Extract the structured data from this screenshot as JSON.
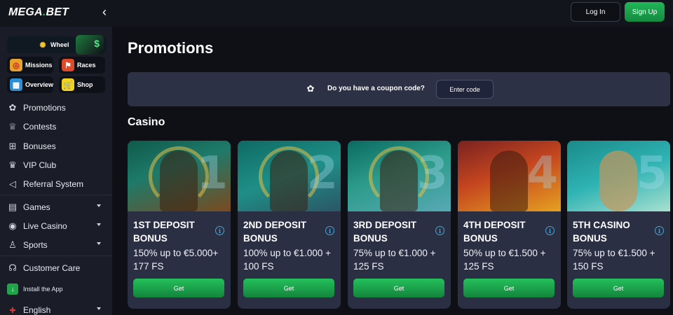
{
  "header": {
    "logo_main": "MEGA",
    "logo_dot": ".",
    "logo_suffix": "BET",
    "collapse_glyph": "‹",
    "login_label": "Log In",
    "signup_label": "Sign Up"
  },
  "sidebar": {
    "tiles": [
      {
        "label": "Wheel",
        "icon": "wheel-icon"
      },
      {
        "label": "Missions",
        "icon": "target-icon"
      },
      {
        "label": "Races",
        "icon": "race-flag-icon"
      },
      {
        "label": "Overview",
        "icon": "grid-icon"
      },
      {
        "label": "Shop",
        "icon": "cart-icon"
      }
    ],
    "nav": [
      {
        "label": "Promotions",
        "icon": "promotions-icon"
      },
      {
        "label": "Contests",
        "icon": "trophy-icon"
      },
      {
        "label": "Bonuses",
        "icon": "gift-icon"
      },
      {
        "label": "VIP Club",
        "icon": "crown-icon"
      },
      {
        "label": "Referral System",
        "icon": "megaphone-icon"
      },
      {
        "label": "Games",
        "icon": "games-icon"
      },
      {
        "label": "Live Casino",
        "icon": "live-casino-icon"
      },
      {
        "label": "Sports",
        "icon": "sports-trophy-icon"
      },
      {
        "label": "Customer Care",
        "icon": "headset-icon"
      },
      {
        "label": "Install the App",
        "icon": "download-icon"
      },
      {
        "label": "English",
        "icon": "uk-flag-icon"
      }
    ]
  },
  "main": {
    "title": "Promotions",
    "coupon": {
      "question": "Do you have a coupon code?",
      "button": "Enter code"
    },
    "section": "Casino",
    "cards": [
      {
        "title": "1ST DEPOSIT BONUS",
        "desc": "150% up to €5.000+ 177 FS",
        "button": "Get",
        "number": "1"
      },
      {
        "title": "2ND DEPOSIT BONUS",
        "desc": "100% up to €1.000 + 100 FS",
        "button": "Get",
        "number": "2"
      },
      {
        "title": "3RD DEPOSIT BONUS",
        "desc": "75% up to €1.000 + 125 FS",
        "button": "Get",
        "number": "3"
      },
      {
        "title": "4TH DEPOSIT BONUS",
        "desc": "50% up to €1.500 + 125 FS",
        "button": "Get",
        "number": "4"
      },
      {
        "title": "5TH CASINO BONUS",
        "desc": "75% up to €1.500 + 150 FS",
        "button": "Get",
        "number": "5"
      }
    ]
  },
  "colors": {
    "accent_green": "#20c95a",
    "background": "#0e1016",
    "sidebar": "#1a1d27",
    "card": "#2b2f44",
    "info_blue": "#44a7d8"
  }
}
